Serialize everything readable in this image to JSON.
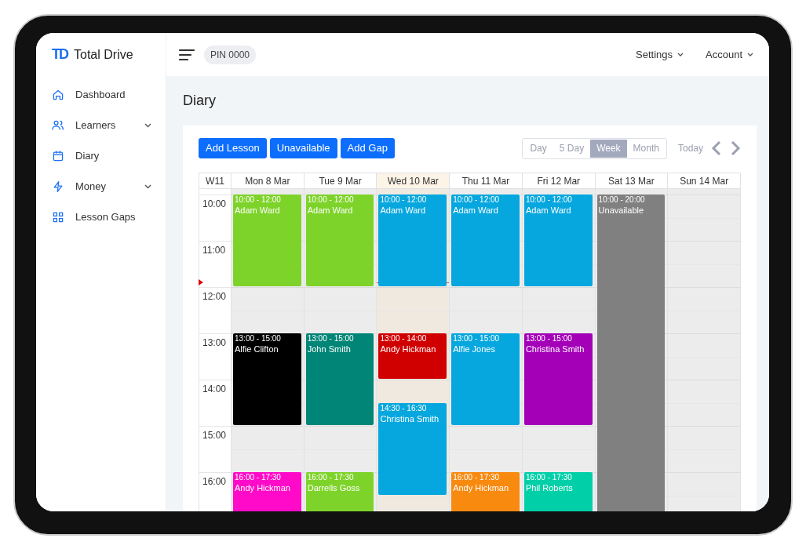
{
  "brand": {
    "logo": "TD",
    "name": "Total Drive"
  },
  "sidebar": {
    "items": [
      {
        "label": "Dashboard",
        "expandable": false
      },
      {
        "label": "Learners",
        "expandable": true
      },
      {
        "label": "Diary",
        "expandable": false
      },
      {
        "label": "Money",
        "expandable": true
      },
      {
        "label": "Lesson Gaps",
        "expandable": false
      }
    ]
  },
  "topbar": {
    "pin": "PIN 0000",
    "menus": [
      "Settings",
      "Account"
    ]
  },
  "page_title": "Diary",
  "actions": [
    "Add Lesson",
    "Unavailable",
    "Add Gap"
  ],
  "views": [
    {
      "label": "Day",
      "selected": false
    },
    {
      "label": "5 Day",
      "selected": false
    },
    {
      "label": "Week",
      "selected": true
    },
    {
      "label": "Month",
      "selected": false
    }
  ],
  "today_button": "Today",
  "calendar": {
    "week": "W11",
    "hours": [
      "10:00",
      "11:00",
      "12:00",
      "13:00",
      "14:00",
      "15:00",
      "16:00"
    ],
    "days": [
      {
        "label": "Mon 8 Mar",
        "today": false,
        "events": [
          {
            "time": "10:00 - 12:00",
            "name": "Adam Ward",
            "color": "#7ed32a"
          },
          {
            "time": "13:00 - 15:00",
            "name": "Alfie Clifton",
            "color": "#000000"
          },
          {
            "time": "16:00 - 17:30",
            "name": "Andy Hickman",
            "color": "#ff0ac8"
          }
        ]
      },
      {
        "label": "Tue 9 Mar",
        "today": false,
        "events": [
          {
            "time": "10:00 - 12:00",
            "name": "Adam Ward",
            "color": "#7ed32a"
          },
          {
            "time": "13:00 - 15:00",
            "name": "John Smith",
            "color": "#008577"
          },
          {
            "time": "16:00 - 17:30",
            "name": "Darrells Goss",
            "color": "#7ed32a"
          }
        ]
      },
      {
        "label": "Wed 10 Mar",
        "today": true,
        "events": [
          {
            "time": "10:00 - 12:00",
            "name": "Adam Ward",
            "color": "#06a7de"
          },
          {
            "time": "13:00 - 14:00",
            "name": "Andy Hickman",
            "color": "#d10000"
          },
          {
            "time": "14:30 - 16:30",
            "name": "Christina Smith",
            "color": "#06a7de"
          }
        ]
      },
      {
        "label": "Thu 11 Mar",
        "today": false,
        "events": [
          {
            "time": "10:00 - 12:00",
            "name": "Adam Ward",
            "color": "#06a7de"
          },
          {
            "time": "13:00 - 15:00",
            "name": "Alfie Jones",
            "color": "#06a7de"
          },
          {
            "time": "16:00 - 17:30",
            "name": "Andy Hickman",
            "color": "#f88a10"
          }
        ]
      },
      {
        "label": "Fri 12 Mar",
        "today": false,
        "events": [
          {
            "time": "10:00 - 12:00",
            "name": "Adam Ward",
            "color": "#06a7de"
          },
          {
            "time": "13:00 - 15:00",
            "name": "Christina Smith",
            "color": "#a300b8"
          },
          {
            "time": "16:00 - 17:30",
            "name": "Phil Roberts",
            "color": "#00cfa8"
          }
        ]
      },
      {
        "label": "Sat 13 Mar",
        "today": false,
        "events": [
          {
            "time": "10:00 - 20:00",
            "name": "Unavailable",
            "color": "#808080"
          }
        ]
      },
      {
        "label": "Sun 14 Mar",
        "today": false
      }
    ]
  }
}
